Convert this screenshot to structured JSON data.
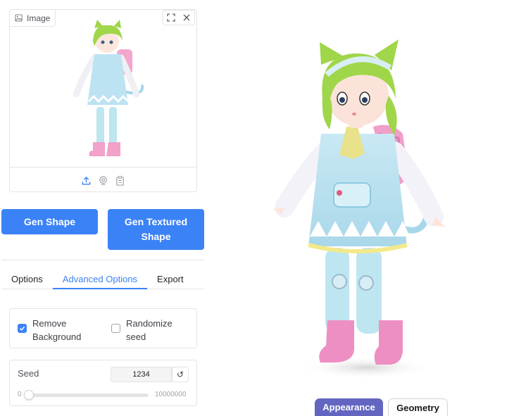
{
  "image_panel": {
    "label": "Image",
    "label_icon": "image-icon",
    "tools": [
      "fullscreen-icon",
      "close-icon"
    ],
    "bottom_actions": [
      "upload-icon",
      "webcam-icon",
      "clipboard-icon"
    ]
  },
  "buttons": {
    "gen_shape": "Gen Shape",
    "gen_textured": "Gen Textured Shape"
  },
  "tabs": [
    {
      "label": "Options",
      "active": false
    },
    {
      "label": "Advanced Options",
      "active": true
    },
    {
      "label": "Export",
      "active": false
    }
  ],
  "checkboxes": {
    "remove_bg": {
      "label": "Remove Background",
      "checked": true
    },
    "randomize_seed": {
      "label": "Randomize seed",
      "checked": false
    }
  },
  "seed": {
    "label": "Seed",
    "value": "1234",
    "reset_icon": "reset-icon",
    "min": "0",
    "max": "10000000",
    "slider_fraction": 0.0001234
  },
  "view_toggle": {
    "appearance": "Appearance",
    "geometry": "Geometry",
    "selected": "Appearance"
  },
  "colors": {
    "accent": "#3b82f6",
    "toggle_active": "#6366c1",
    "border": "#e4e4e7"
  }
}
